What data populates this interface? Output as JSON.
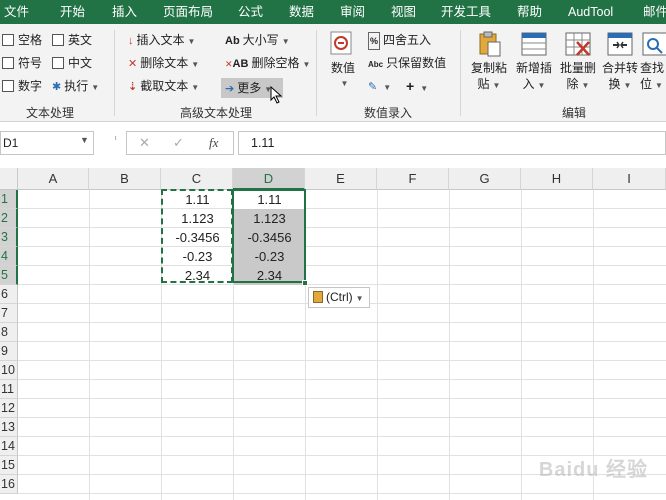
{
  "tabs": [
    "文件",
    "开始",
    "插入",
    "页面布局",
    "公式",
    "数据",
    "审阅",
    "视图",
    "开发工具",
    "帮助",
    "AudTool",
    "邮件"
  ],
  "ribbon": {
    "text_group": {
      "items": [
        "空格",
        "英文",
        "符号",
        "中文",
        "数字",
        "执行"
      ],
      "label": "文本处理"
    },
    "advanced_group": {
      "insert_text": "插入文本",
      "delete_text": "删除文本",
      "extract_text": "截取文本",
      "case": "大小写",
      "delete_space": "删除空格",
      "more": "更多",
      "label": "高级文本处理",
      "icon_ab": "Ab",
      "icon_abb": "AB",
      "icon_abc": "Abc"
    },
    "number_group": {
      "value": "数值",
      "round": "四舍五入",
      "keep_value": "只保留数值",
      "label": "数值录入"
    },
    "edit_group": {
      "buttons": [
        {
          "line1": "复制粘",
          "line2": "贴"
        },
        {
          "line1": "新增插",
          "line2": "入"
        },
        {
          "line1": "批量删",
          "line2": "除"
        },
        {
          "line1": "合并转",
          "line2": "换"
        },
        {
          "line1": "查找",
          "line2": "位"
        }
      ],
      "label": "编辑"
    }
  },
  "formula_bar": {
    "name_box": "D1",
    "fx": "fx",
    "cancel": "✕",
    "confirm": "✓",
    "content": "1.11"
  },
  "sheet": {
    "columns": [
      "A",
      "B",
      "C",
      "D",
      "E",
      "F",
      "G",
      "H",
      "I"
    ],
    "rows": [
      "1",
      "2",
      "3",
      "4",
      "5",
      "6",
      "7",
      "8",
      "9",
      "10",
      "11",
      "12",
      "13",
      "14",
      "15",
      "16"
    ],
    "col_C": [
      "1.11",
      "1.123",
      "-0.3456",
      "-0.23",
      "2.34"
    ],
    "col_D": [
      "1.11",
      "1.123",
      "-0.3456",
      "-0.23",
      "2.34"
    ]
  },
  "paste_options": "(Ctrl)",
  "watermark": "Baidu 经验",
  "colors": {
    "accent": "#217346",
    "ribbon_bg": "#f3f3f3",
    "selection": "#c9c9c9"
  }
}
